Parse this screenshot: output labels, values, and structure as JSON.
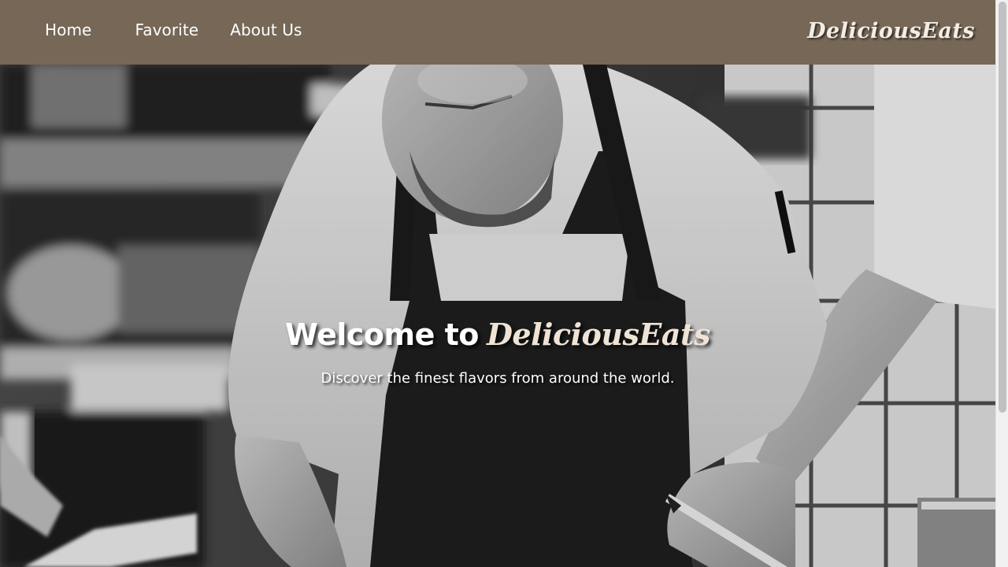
{
  "nav": {
    "items": [
      {
        "label": "Home"
      },
      {
        "label": "Favorite"
      },
      {
        "label": "About Us"
      }
    ],
    "brand": "DeliciousEats",
    "background": "#766757"
  },
  "hero": {
    "title_prefix": "Welcome to",
    "title_brand": "DeliciousEats",
    "subtitle": "Discover the finest flavors from around the world.",
    "image_description_icon": "chef-photo"
  },
  "scrollbar": {
    "position": 0
  }
}
